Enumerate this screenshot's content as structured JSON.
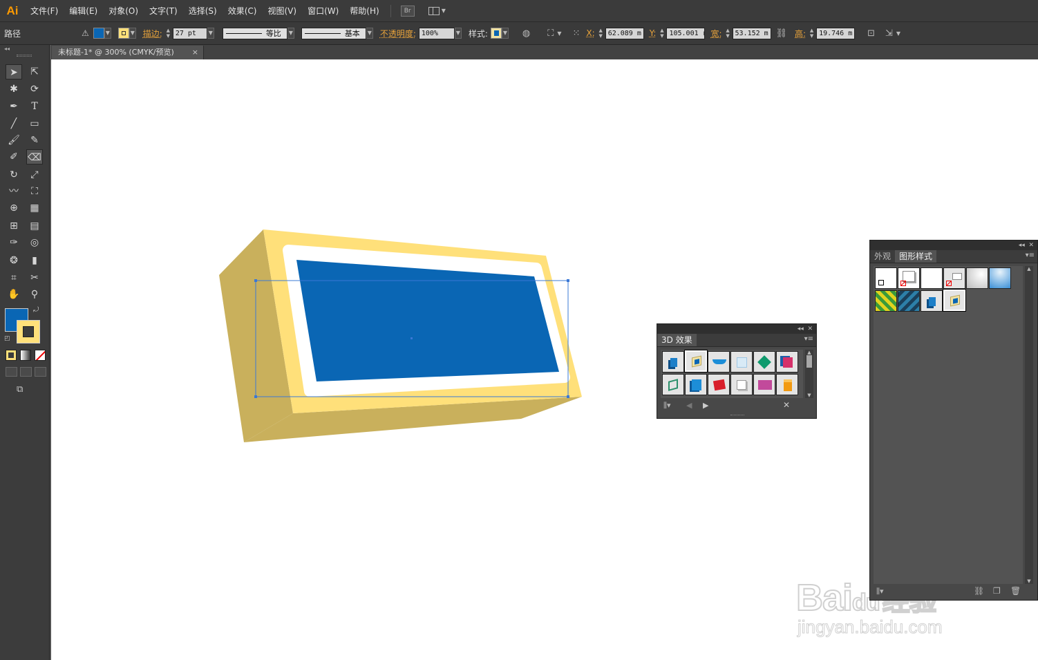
{
  "app": {
    "logo": "Ai"
  },
  "menu": {
    "items": [
      "文件(F)",
      "编辑(E)",
      "对象(O)",
      "文字(T)",
      "选择(S)",
      "效果(C)",
      "视图(V)",
      "窗口(W)",
      "帮助(H)"
    ],
    "bridge_label": "Br"
  },
  "control": {
    "path_label": "路径",
    "stroke_label": "描边:",
    "stroke_value": "27 pt",
    "profile_label": "等比",
    "brush_label": "基本",
    "opacity_label": "不透明度:",
    "opacity_value": "100%",
    "style_label": "样式:",
    "x_label": "X:",
    "x_value": "62.089 m",
    "y_label": "Y:",
    "y_value": "105.001 r",
    "w_label": "宽:",
    "w_value": "53.152 m",
    "h_label": "高:",
    "h_value": "19.746 m",
    "fill_color": "#0a66b4",
    "stroke_color": "#ffe07a"
  },
  "document": {
    "tab_title": "未标题-1* @ 300% (CMYK/预览)",
    "close_glyph": "×"
  },
  "panels": {
    "effects3d": {
      "title": "3D 效果"
    },
    "appearance": {
      "tabs": [
        "外观",
        "图形样式"
      ]
    }
  },
  "artwork": {
    "box_light": "#ffe07a",
    "box_dark": "#c9b05c",
    "inner_white": "#ffffff",
    "inner_blue": "#0a66b4",
    "selection": "#3a78d6"
  },
  "watermark": {
    "brand": "Bai",
    "brand2": "du",
    "brand3": "经验",
    "url": "jingyan.baidu.com"
  }
}
